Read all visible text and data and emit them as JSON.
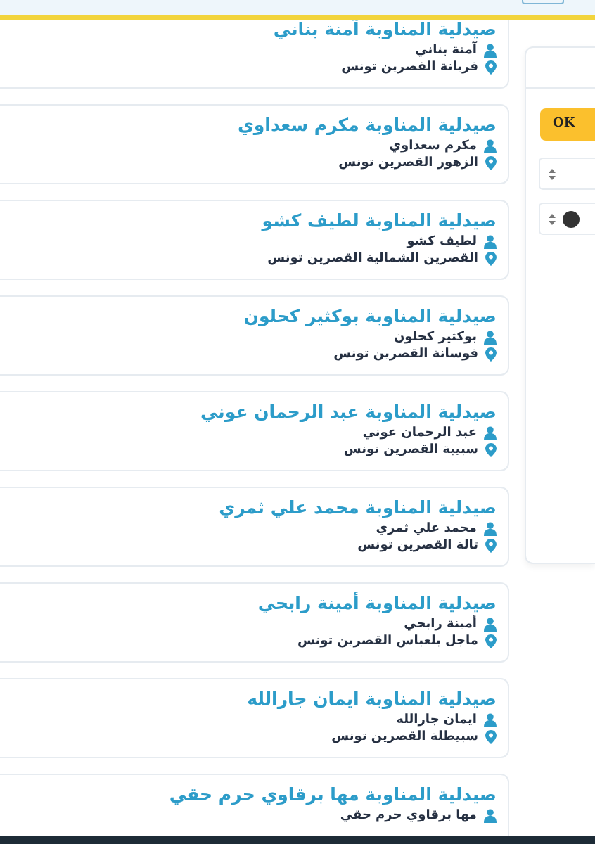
{
  "pharmacies": [
    {
      "title": "صيدلية المناوبة آمنة بناني",
      "owner": "آمنة بناني",
      "address": "فريانة القصرين تونس"
    },
    {
      "title": "صيدلية المناوبة مكرم سعداوي",
      "owner": "مكرم سعداوي",
      "address": "الزهور القصرين تونس"
    },
    {
      "title": "صيدلية المناوبة لطيف كشو",
      "owner": "لطيف كشو",
      "address": "القصرين الشمالية القصرين تونس"
    },
    {
      "title": "صيدلية المناوبة بوكثير كحلون",
      "owner": "بوكثير كحلون",
      "address": "فوسانة القصرين تونس"
    },
    {
      "title": "صيدلية المناوبة عبد الرحمان عوني",
      "owner": "عبد الرحمان عوني",
      "address": "سبيبة القصرين تونس"
    },
    {
      "title": "صيدلية المناوبة محمد علي ثمري",
      "owner": "محمد علي ثمري",
      "address": "تالة القصرين تونس"
    },
    {
      "title": "صيدلية المناوبة أمينة رابحي",
      "owner": "أمينة رابحي",
      "address": "ماجل بلعباس القصرين تونس"
    },
    {
      "title": "صيدلية المناوبة ايمان جارالله",
      "owner": "ايمان جارالله",
      "address": "سبيطلة القصرين تونس"
    },
    {
      "title": "صيدلية المناوبة مها برقاوي حرم حقي",
      "owner": "مها برقاوي حرم حقي"
    }
  ],
  "side_panel": {
    "ok_button": "OK",
    "filters": [
      {
        "kind": "select"
      },
      {
        "kind": "select-with-icon"
      }
    ]
  }
}
